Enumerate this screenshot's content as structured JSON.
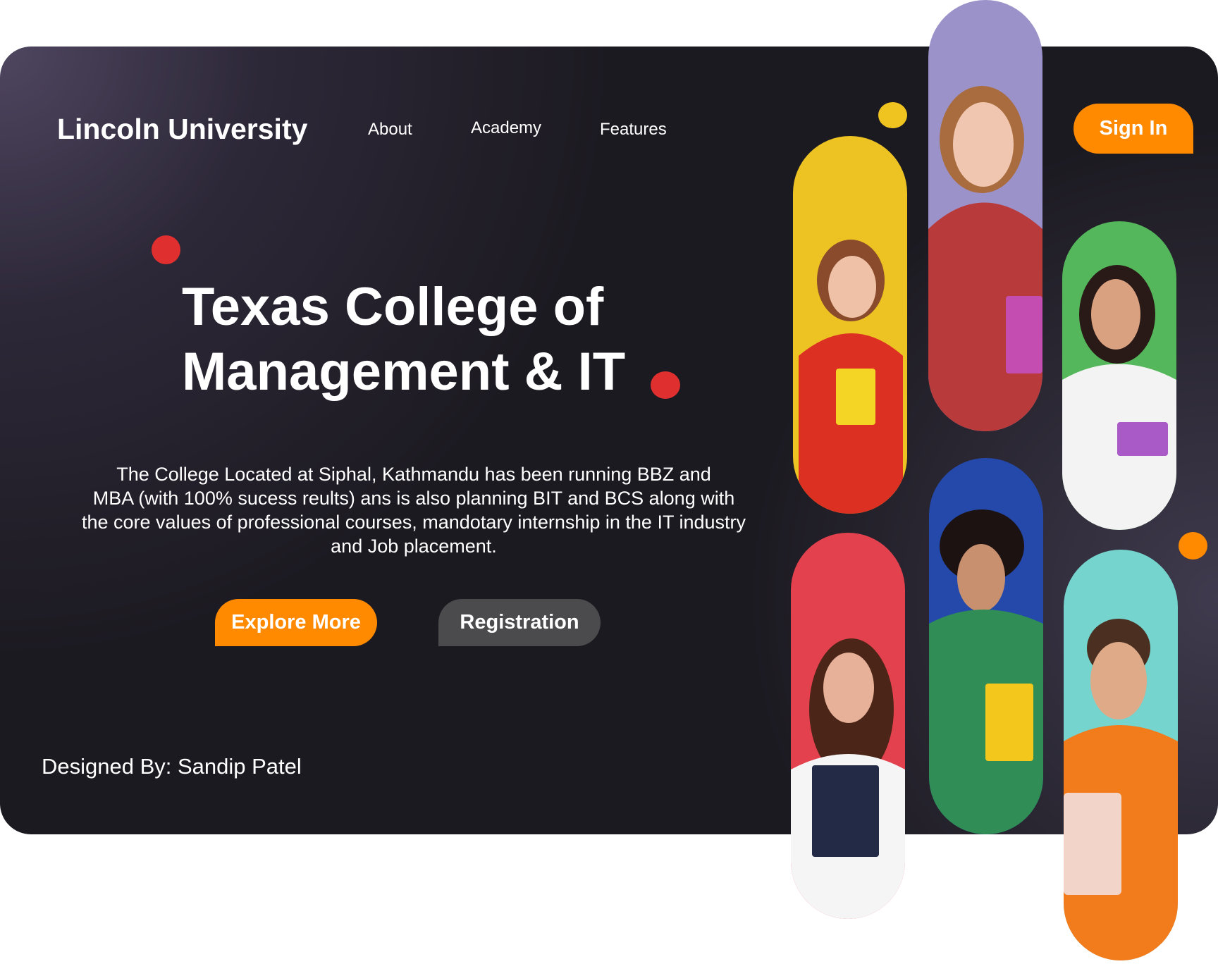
{
  "brand": "Lincoln University",
  "nav": {
    "about": "About",
    "academy": "Academy",
    "features": "Features"
  },
  "actions": {
    "sign_in": "Sign In",
    "explore": "Explore More",
    "register": "Registration"
  },
  "hero": {
    "title_line1": "Texas College of",
    "title_line2": "Management & IT",
    "description_lines": [
      "The College Located at Siphal, Kathmandu has been running BBZ and",
      "MBA (with 100% sucess reults) ans is also planning BIT and BCS along with",
      "the core values of professional courses, mandotary internship in the IT industry",
      "and Job placement."
    ]
  },
  "credit": "Designed By: Sandip Patel",
  "colors": {
    "background": "#1c1a21",
    "accent_orange": "#ff8a00",
    "accent_red": "#df2f2f",
    "accent_yellow": "#f0c420",
    "secondary_button": "#4b4a4c"
  },
  "photo_cards": [
    {
      "name": "student-yellow-red-hoodie",
      "bg": "#ecc323",
      "skin": "#efc2a8",
      "hair": "#8a4b2c",
      "shirt": "#dc3023",
      "item": "#f4d526"
    },
    {
      "name": "student-purple-plaid",
      "bg": "#9b92c9",
      "skin": "#f0c6b0",
      "hair": "#a96c3e",
      "shirt": "#b93a3a",
      "item": "#c34db1"
    },
    {
      "name": "student-green-white-blouse",
      "bg": "#55b75b",
      "skin": "#d9a17f",
      "hair": "#2a1a17",
      "shirt": "#f3f3f3",
      "item": "#a95ac7"
    },
    {
      "name": "student-red-bg-books",
      "bg": "#e4414e",
      "skin": "#e7b098",
      "hair": "#4b2517",
      "shirt": "#f5f5f5",
      "item": "#222a45"
    },
    {
      "name": "student-blue-green-plaid",
      "bg": "#2449aa",
      "skin": "#c9906f",
      "hair": "#1d1212",
      "shirt": "#2f8d55",
      "item": "#f3c71c"
    },
    {
      "name": "student-teal-orange-sweater",
      "bg": "#76d4ce",
      "skin": "#deaa88",
      "hair": "#4b2f20",
      "shirt": "#f27b1c",
      "item": "#f2d5c8"
    }
  ]
}
